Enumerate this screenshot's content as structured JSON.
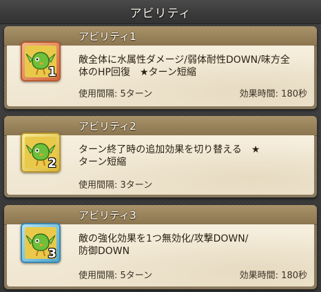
{
  "header": {
    "title": "アビリティ"
  },
  "abilities": [
    {
      "name": "アビリティ1",
      "number": "1",
      "frame_color": "red",
      "description_line1": "敵全体に水属性ダメージ/弱体耐性DOWN/味方全",
      "description_line2": "体のHP回復　★ターン短縮",
      "interval": "使用間隔: 5ターン",
      "duration": "効果時間: 180秒"
    },
    {
      "name": "アビリティ2",
      "number": "2",
      "frame_color": "yellow",
      "description_line1": "ターン終了時の追加効果を切り替える　★",
      "description_line2": "ターン短縮",
      "interval": "使用間隔: 3ターン",
      "duration": ""
    },
    {
      "name": "アビリティ3",
      "number": "3",
      "frame_color": "blue",
      "description_line1": "敵の強化効果を1つ無効化/攻撃DOWN/",
      "description_line2": "防御DOWN",
      "interval": "使用間隔: 5ターン",
      "duration": "効果時間: 180秒"
    }
  ],
  "icon_names": [
    "green-bird-icon"
  ],
  "colors": {
    "card_title_bar": "#a9936a",
    "card_body": "#f6efde",
    "text": "#2a2014"
  }
}
